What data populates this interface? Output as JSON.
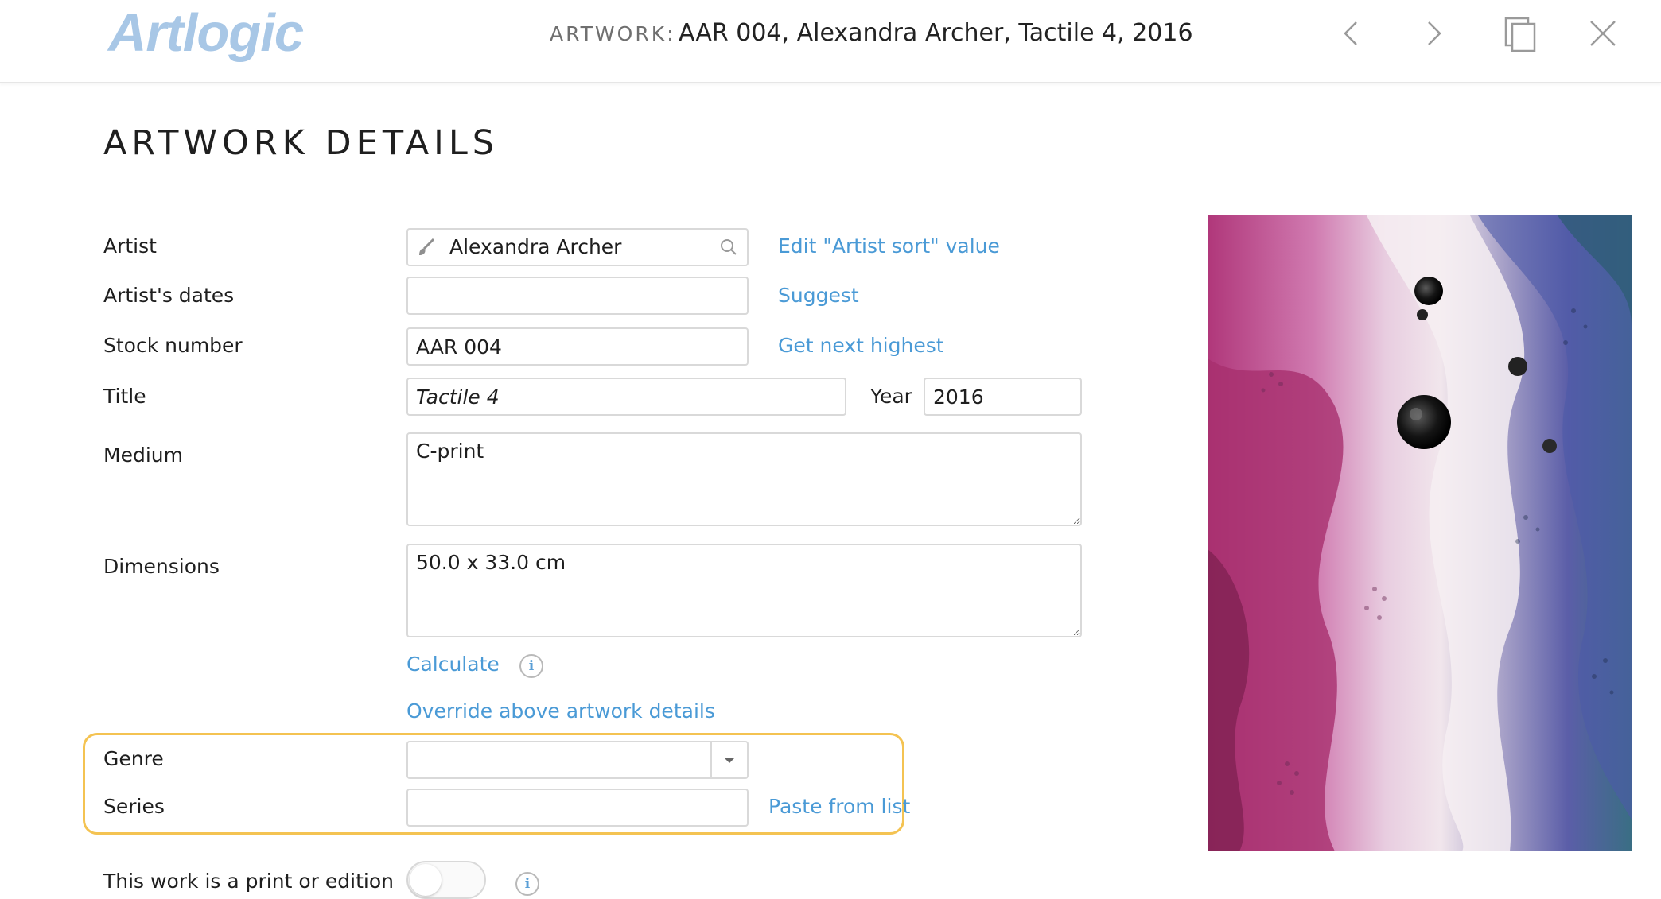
{
  "header": {
    "logo": "Artlogic",
    "prefix": "ARTWORK:",
    "title": "AAR 004, Alexandra Archer, Tactile 4, 2016",
    "icons": [
      "chevron-left-icon",
      "chevron-right-icon",
      "duplicate-icon",
      "close-icon"
    ]
  },
  "page": {
    "title": "ARTWORK DETAILS"
  },
  "form": {
    "artist": {
      "label": "Artist",
      "value": "Alexandra Archer",
      "link": "Edit \"Artist sort\" value"
    },
    "artist_dates": {
      "label": "Artist's dates",
      "value": "",
      "link": "Suggest"
    },
    "stock_number": {
      "label": "Stock number",
      "value": "AAR 004",
      "link": "Get next highest"
    },
    "title": {
      "label": "Title",
      "value": "Tactile 4"
    },
    "year": {
      "label": "Year",
      "value": "2016"
    },
    "medium": {
      "label": "Medium",
      "value": "C-print"
    },
    "dimensions": {
      "label": "Dimensions",
      "value": "50.0 x 33.0 cm"
    },
    "calculate_link": "Calculate",
    "override_link": "Override above artwork details",
    "genre": {
      "label": "Genre",
      "value": ""
    },
    "series": {
      "label": "Series",
      "value": "",
      "link": "Paste from list"
    },
    "print_edition": {
      "label": "This work is a print or edition",
      "toggled": false
    }
  },
  "colors": {
    "link": "#4a9ad6",
    "highlight_border": "#f4c352",
    "logo": "#a8c7e6"
  }
}
